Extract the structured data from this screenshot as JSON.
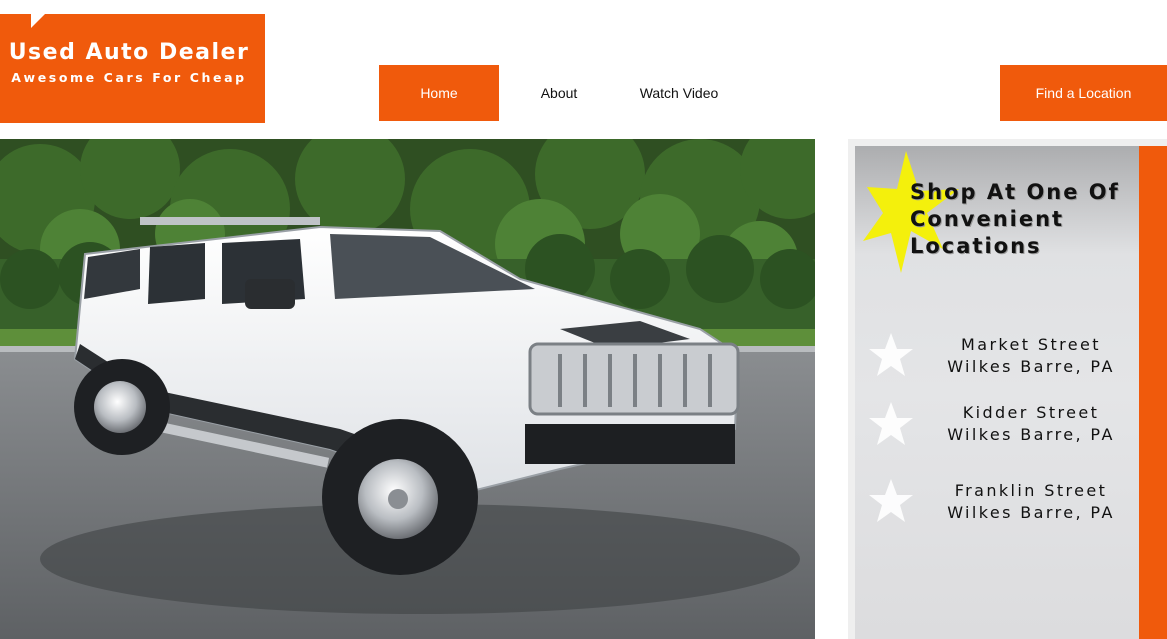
{
  "logo": {
    "title": "Used Auto Dealer",
    "tagline": "Awesome Cars For Cheap"
  },
  "nav": {
    "items": [
      {
        "label": "Home",
        "active": true
      },
      {
        "label": "About",
        "active": false
      },
      {
        "label": "Watch Video",
        "active": false
      }
    ],
    "find_location": "Find a Location"
  },
  "sidebar": {
    "heading_lines": [
      "Shop At One Of",
      "Convenient",
      "Locations"
    ],
    "locations": [
      {
        "street": "Market Street",
        "city": "Wilkes Barre, PA"
      },
      {
        "street": "Kidder Street",
        "city": "Wilkes Barre, PA"
      },
      {
        "street": "Franklin Street",
        "city": "Wilkes Barre, PA"
      }
    ]
  },
  "colors": {
    "accent": "#f05a0c",
    "starburst": "#f4f00c"
  }
}
